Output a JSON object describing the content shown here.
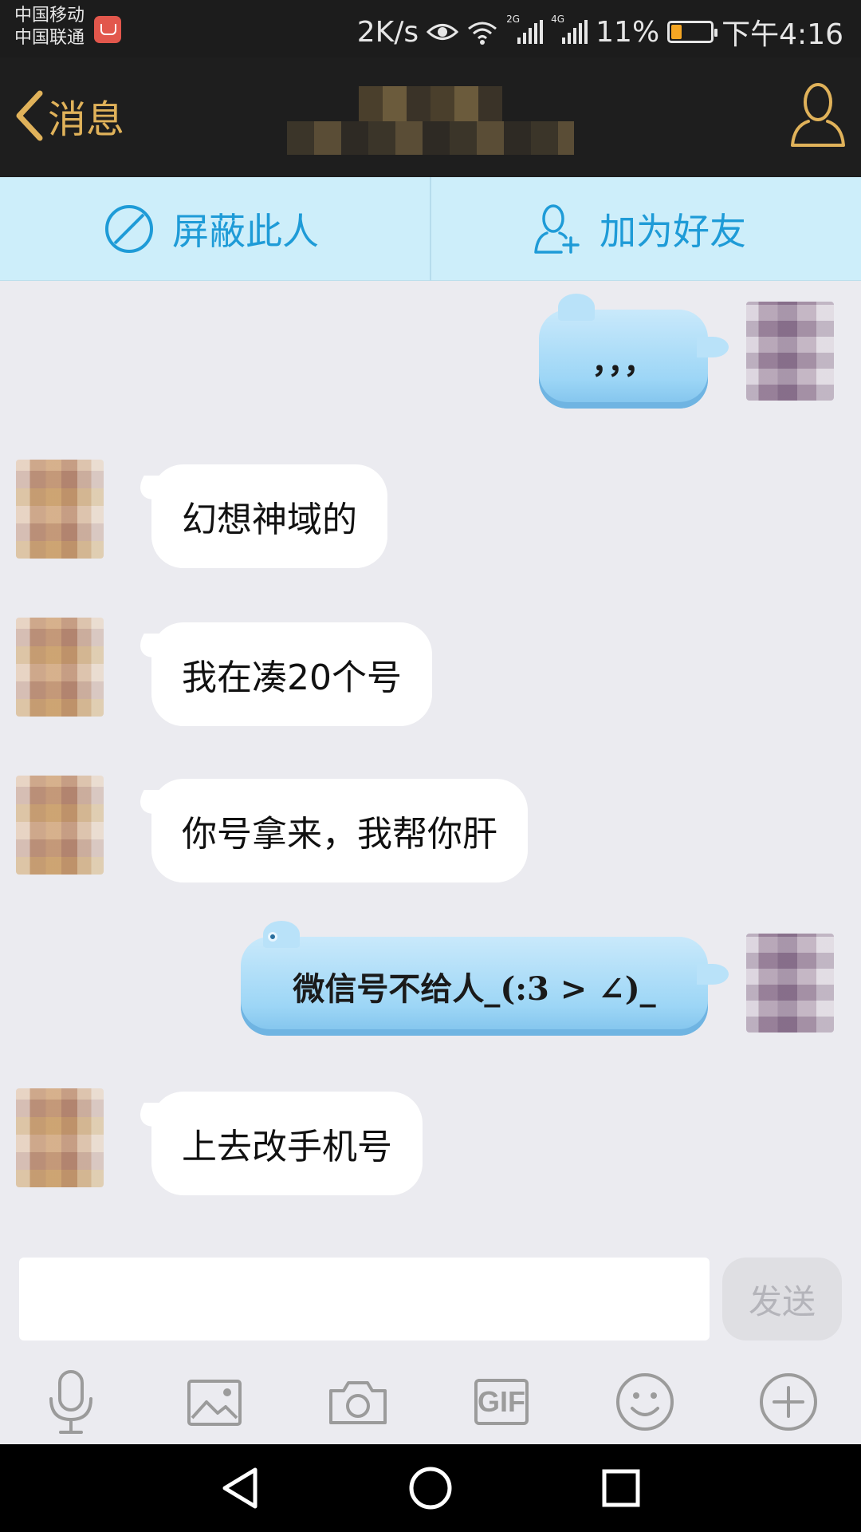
{
  "status_bar": {
    "carrier_1": "中国移动",
    "carrier_2": "中国联通",
    "net_speed": "2K/s",
    "signal_1_type": "2G",
    "signal_2_type": "4G",
    "battery": "11%",
    "battery_level": 0.11,
    "time": "下午4:16",
    "battery_color": "#f5a623"
  },
  "title_bar": {
    "back_label": "消息",
    "accent_color": "#e0b25a",
    "back_icon": "chevron-left-icon",
    "profile_icon": "person-outline-icon"
  },
  "action_bar": {
    "block_label": "屏蔽此人",
    "add_friend_label": "加为好友",
    "accent_color": "#1e9bd7"
  },
  "messages": [
    {
      "side": "out",
      "text": "，，，"
    },
    {
      "side": "in",
      "text": "幻想神域的"
    },
    {
      "side": "in",
      "text": "我在凑20个号"
    },
    {
      "side": "in",
      "text": "你号拿来，我帮你肝"
    },
    {
      "side": "out",
      "text": "微信号不给人_(:3 > ∠)_"
    },
    {
      "side": "in",
      "text": "上去改手机号"
    }
  ],
  "input": {
    "value": "",
    "send_label": "发送"
  },
  "toolbar": {
    "items": [
      "microphone-icon",
      "image-icon",
      "camera-icon",
      "gif-icon",
      "emoji-icon",
      "plus-icon"
    ],
    "gif_label": "GIF"
  },
  "nav_bar": {
    "items": [
      "back-triangle-icon",
      "home-circle-icon",
      "recents-square-icon"
    ]
  }
}
